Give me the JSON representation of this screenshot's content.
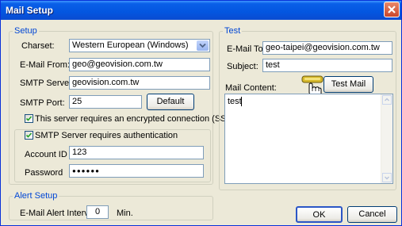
{
  "window": {
    "title": "Mail Setup"
  },
  "setup": {
    "legend": "Setup",
    "charset_label": "Charset:",
    "charset_value": "Western European (Windows)",
    "from_label": "E-Mail From:",
    "from_value": "geo@geovision.com.tw",
    "smtp_label": "SMTP Server:",
    "smtp_value": "geovision.com.tw",
    "port_label": "SMTP Port:",
    "port_value": "25",
    "default_button": "Default",
    "ssl_label": "This server requires an encrypted connection (SSL)",
    "ssl_checked": true,
    "auth_label": "SMTP Server requires authentication",
    "auth_checked": true,
    "account_label": "Account ID",
    "account_value": "123",
    "password_label": "Password",
    "password_value": "●●●●●●"
  },
  "alert": {
    "legend": "Alert Setup",
    "interval_label": "E-Mail Alert Interval:",
    "interval_value": "0",
    "unit": "Min."
  },
  "test": {
    "legend": "Test",
    "to_label": "E-Mail To:",
    "to_value": "geo-taipei@geovision.com.tw",
    "subject_label": "Subject:",
    "subject_value": "test",
    "content_label": "Mail Content:",
    "content_value": "test",
    "test_button": "Test Mail"
  },
  "footer": {
    "ok": "OK",
    "cancel": "Cancel"
  },
  "icons": {
    "close": "close-icon",
    "dropdown": "chevron-down-icon",
    "cursor": "hand-pointer-icon"
  }
}
